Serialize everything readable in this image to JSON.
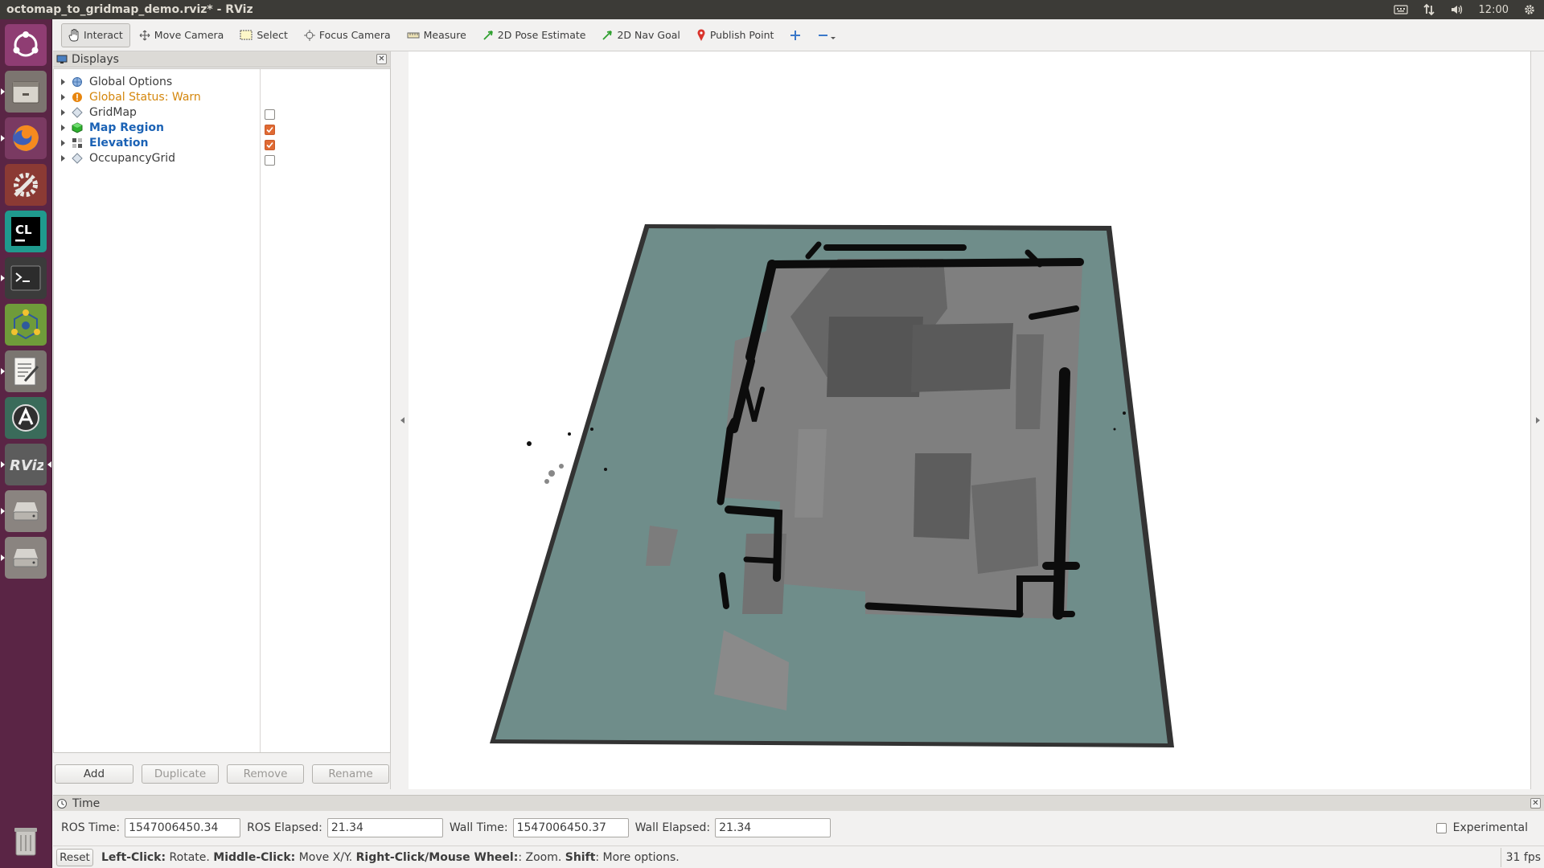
{
  "window": {
    "title": "octomap_to_gridmap_demo.rviz* - RViz",
    "clock": "12:00"
  },
  "toolbar": {
    "tools": [
      {
        "label": "Interact",
        "icon": "hand-icon",
        "active": true
      },
      {
        "label": "Move Camera",
        "icon": "move-camera-icon"
      },
      {
        "label": "Select",
        "icon": "select-icon"
      },
      {
        "label": "Focus Camera",
        "icon": "focus-camera-icon"
      },
      {
        "label": "Measure",
        "icon": "measure-icon"
      },
      {
        "label": "2D Pose Estimate",
        "icon": "pose-arrow-icon"
      },
      {
        "label": "2D Nav Goal",
        "icon": "nav-goal-arrow-icon"
      },
      {
        "label": "Publish Point",
        "icon": "map-pin-icon"
      }
    ]
  },
  "displays": {
    "title": "Displays",
    "items": [
      {
        "label": "Global Options",
        "checked": null,
        "style": "normal"
      },
      {
        "label": "Global Status: Warn",
        "checked": null,
        "style": "warn"
      },
      {
        "label": "GridMap",
        "checked": false,
        "style": "normal"
      },
      {
        "label": "Map Region",
        "checked": true,
        "style": "highlight"
      },
      {
        "label": "Elevation",
        "checked": true,
        "style": "highlight"
      },
      {
        "label": "OccupancyGrid",
        "checked": false,
        "style": "normal"
      }
    ],
    "buttons": {
      "add": "Add",
      "duplicate": "Duplicate",
      "remove": "Remove",
      "rename": "Rename"
    }
  },
  "time": {
    "title": "Time",
    "ros_time_label": "ROS Time:",
    "ros_time": "1547006450.34",
    "ros_elapsed_label": "ROS Elapsed:",
    "ros_elapsed": "21.34",
    "wall_time_label": "Wall Time:",
    "wall_time": "1547006450.37",
    "wall_elapsed_label": "Wall Elapsed:",
    "wall_elapsed": "21.34",
    "experimental_label": "Experimental"
  },
  "status": {
    "reset": "Reset",
    "hint_b1": "Left-Click:",
    "hint_t1": " Rotate. ",
    "hint_b2": "Middle-Click:",
    "hint_t2": " Move X/Y. ",
    "hint_b3": "Right-Click/Mouse Wheel:",
    "hint_t3": ": Zoom. ",
    "hint_b4": "Shift",
    "hint_t4": ": More options.",
    "fps": "31 fps"
  },
  "colors": {
    "map_plane": "#6f8d8a",
    "launcher": "#5a2545",
    "warn": "#d4860b",
    "highlight": "#1b62b5"
  }
}
